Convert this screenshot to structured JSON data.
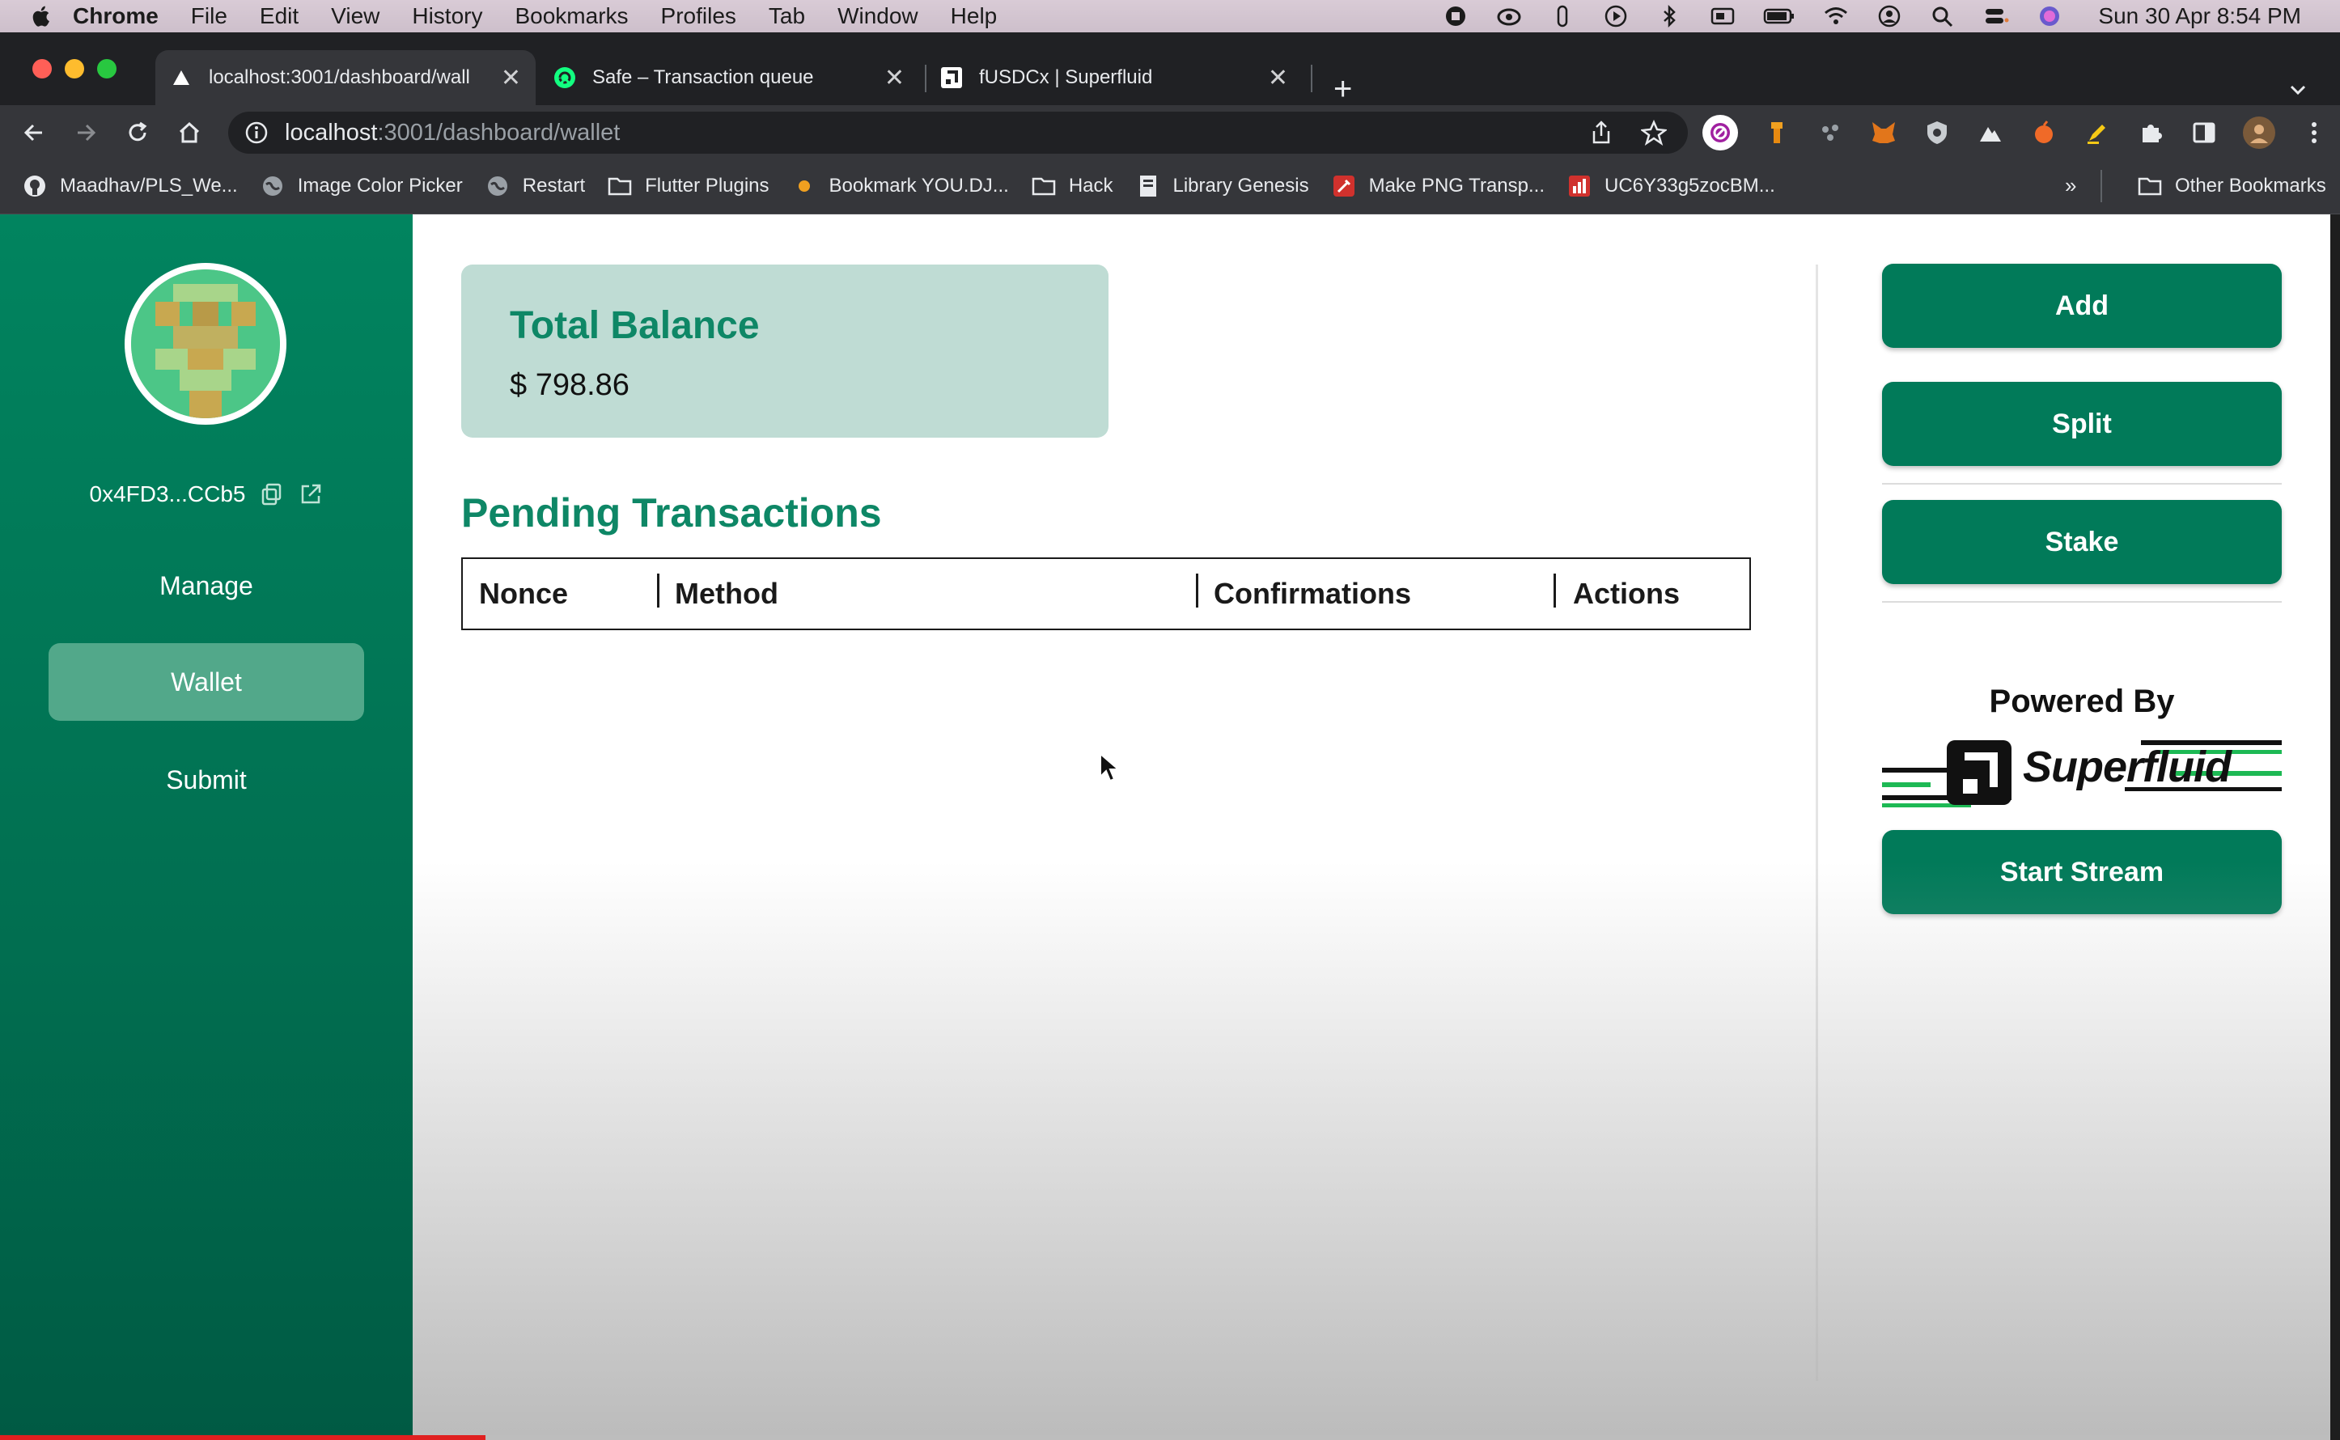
{
  "menubar": {
    "app": "Chrome",
    "items": [
      "File",
      "Edit",
      "View",
      "History",
      "Bookmarks",
      "Profiles",
      "Tab",
      "Window",
      "Help"
    ],
    "clock": "Sun 30 Apr  8:54 PM"
  },
  "tabs": [
    {
      "title": "localhost:3001/dashboard/wall",
      "icon": "triangle-favicon",
      "active": true
    },
    {
      "title": "Safe – Transaction queue",
      "icon": "safe-favicon",
      "active": false
    },
    {
      "title": "fUSDCx | Superfluid",
      "icon": "superfluid-favicon",
      "active": false
    }
  ],
  "address_bar": {
    "host": "localhost",
    "path": ":3001/dashboard/wallet"
  },
  "bookmarks": [
    {
      "label": "Maadhav/PLS_We...",
      "icon": "github-icon"
    },
    {
      "label": "Image Color Picker",
      "icon": "globe-icon"
    },
    {
      "label": "Restart",
      "icon": "globe-icon"
    },
    {
      "label": "Flutter Plugins",
      "icon": "folder-icon"
    },
    {
      "label": "Bookmark YOU.DJ...",
      "icon": "dot-icon"
    },
    {
      "label": "Hack",
      "icon": "folder-icon"
    },
    {
      "label": "Library Genesis",
      "icon": "book-icon"
    },
    {
      "label": "Make PNG Transp...",
      "icon": "tool-icon"
    },
    {
      "label": "UC6Y33g5zocBM...",
      "icon": "chart-icon"
    }
  ],
  "bookmarks_more": "»",
  "bookmarks_other": "Other Bookmarks",
  "sidebar": {
    "address": "0x4FD3...CCb5",
    "nav": [
      {
        "label": "Manage",
        "active": false
      },
      {
        "label": "Wallet",
        "active": true
      },
      {
        "label": "Submit",
        "active": false
      }
    ]
  },
  "balance": {
    "title": "Total Balance",
    "value": "$ 798.86"
  },
  "pending": {
    "title": "Pending Transactions",
    "columns": [
      "Nonce",
      "Method",
      "Confirmations",
      "Actions"
    ]
  },
  "actions": {
    "add": "Add",
    "split": "Split",
    "stake": "Stake",
    "powered_by": "Powered By",
    "brand": "Superfluid",
    "start_stream": "Start Stream"
  },
  "colors": {
    "primary": "#017a59",
    "sidebar": "#01845f",
    "accent_text": "#0e8766",
    "card": "#bfdcd4",
    "active_nav": "#52a88a"
  }
}
